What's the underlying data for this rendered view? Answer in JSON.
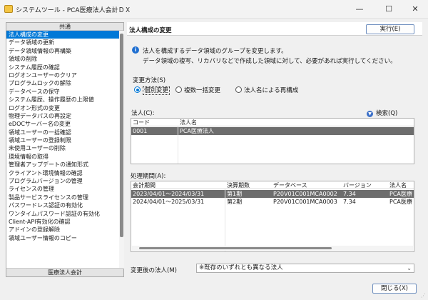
{
  "window": {
    "title": "システムツール - PCA医療法人会計ＤＸ",
    "min": "—",
    "max": "☐",
    "close": "✕"
  },
  "sidebar": {
    "header": "共通",
    "footer": "医療法人会計",
    "items": [
      "法人構成の変更",
      "データ領域の更新",
      "データ領域情報の再構築",
      "領域の削除",
      "システム履歴の確認",
      "ログオンユーザーのクリア",
      "プログラムロックの解除",
      "データベースの保守",
      "システム履歴、操作履歴の上限値",
      "ログオン形式の変更",
      "物理データパスの再設定",
      "eDOCサーバー名の変更",
      "領域ユーザーの一括確認",
      "領域ユーザーの登録制限",
      "未使用ユーザーの削除",
      "環境情報の取得",
      "管理者アップデートの通知形式",
      "クライアント環境情報の確認",
      "プログラムバージョンの管理",
      "ライセンスの管理",
      "製品サービスライセンスの管理",
      "パスワードレス認証の有効化",
      "ワンタイムパスワード認証の有効化",
      "Client-API有効化の確認",
      "アドインの登録解除",
      "領域ユーザー情報のコピー"
    ]
  },
  "main": {
    "title": "法人構成の変更",
    "execute_label": "実行(E)",
    "info_icon": "info-icon",
    "description_1": "法人を構成するデータ領域のグループを変更します。",
    "description_2": "データ領域の複写、リカバリなどで作成した領域に対して、必要があれば実行してください。",
    "method_label": "変更方法(S)",
    "methods": [
      "個別変更",
      "複数一括変更",
      "法人名による再構成"
    ],
    "corp_label": "法人(C):",
    "search_label": "検索(Q)",
    "corp_table": {
      "headers": [
        "コード",
        "法人名"
      ],
      "rows": [
        [
          "0001",
          "PCA医療法人"
        ]
      ]
    },
    "period_label": "処理期間(A):",
    "period_table": {
      "headers": [
        "会計期間",
        "決算期数",
        "データベース",
        "バージョン",
        "法人名"
      ],
      "rows": [
        [
          "2023/04/01～2024/03/31",
          "第1期",
          "P20V01C001MCA0002",
          "7.34",
          "PCA医療"
        ],
        [
          "2024/04/01～2025/03/31",
          "第2期",
          "P20V01C001MCA0003",
          "7.34",
          "PCA医療"
        ]
      ]
    },
    "after_label": "変更後の法人(M)",
    "after_value": "※既存のいずれとも異なる法人",
    "close_label": "閉じる(X)"
  },
  "colors": {
    "accent": "#0078d7",
    "selected_row": "#6d6d6d"
  }
}
